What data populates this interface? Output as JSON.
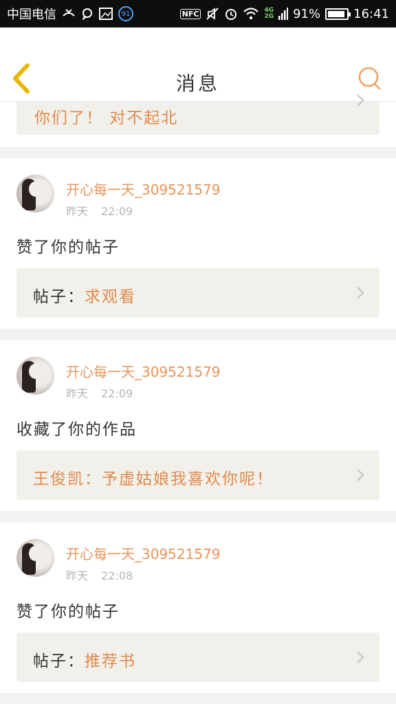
{
  "status_bar": {
    "carrier": "中国电信",
    "notification_badge": "91",
    "nfc": "NFC",
    "network_top": "4G",
    "network_bottom": "2G",
    "battery": "91%",
    "battery_level": 0.91,
    "time": "16:41"
  },
  "header": {
    "title": "消息"
  },
  "partial_card": {
    "text": "你们了！ 对不起北"
  },
  "messages": [
    {
      "user": "开心每一天_309521579",
      "day": "昨天",
      "time": "22:09",
      "action": "赞了你的帖子",
      "ref_label": "帖子：",
      "ref_value": "求观看"
    },
    {
      "user": "开心每一天_309521579",
      "day": "昨天",
      "time": "22:09",
      "action": "收藏了你的作品",
      "ref_label": "",
      "ref_value": "王俊凯：予虚姑娘我喜欢你呢！"
    },
    {
      "user": "开心每一天_309521579",
      "day": "昨天",
      "time": "22:08",
      "action": "赞了你的帖子",
      "ref_label": "帖子：",
      "ref_value": "推荐书"
    }
  ],
  "colors": {
    "accent": "#e7935a",
    "ref_bg": "#f1f0ea",
    "back_arrow": "#e8b800"
  }
}
